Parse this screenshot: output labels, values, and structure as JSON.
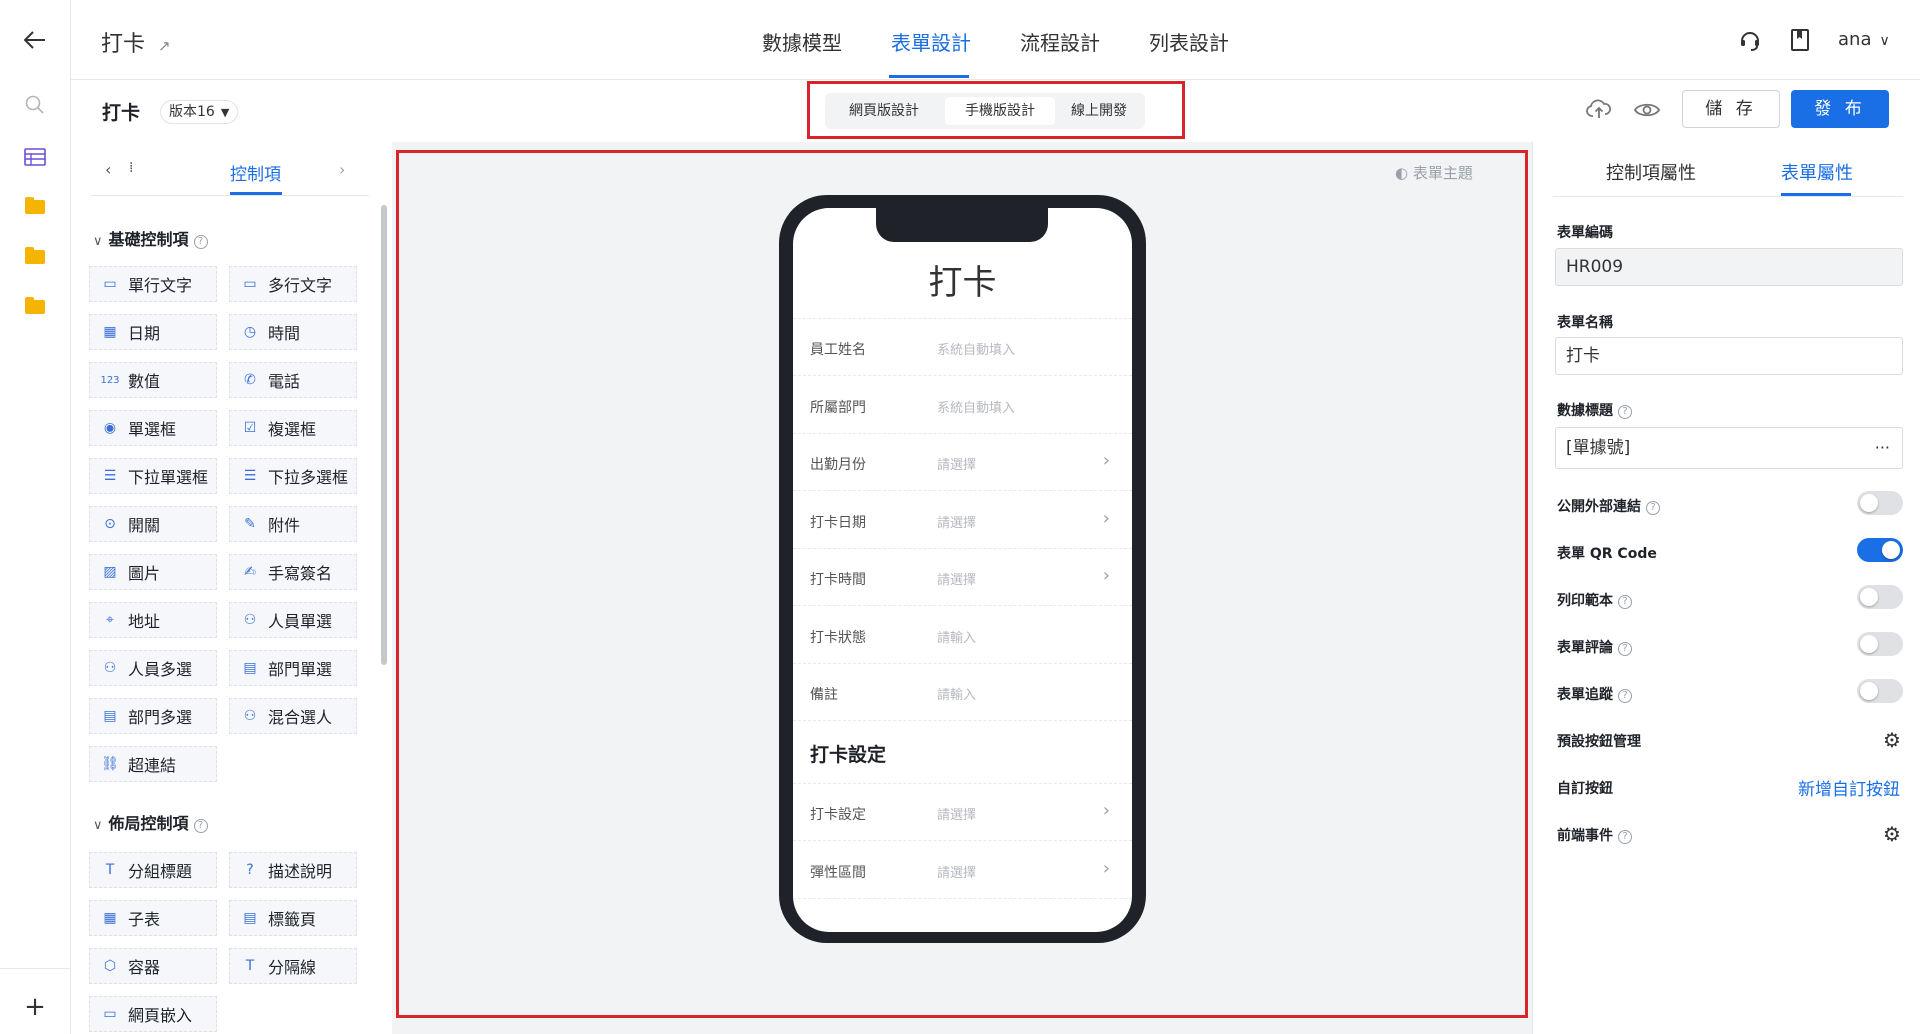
{
  "header": {
    "app_title": "打卡",
    "tabs": [
      "數據模型",
      "表單設計",
      "流程設計",
      "列表設計"
    ],
    "user": "ana"
  },
  "subheader": {
    "form_name": "打卡",
    "version": "版本16",
    "segments": [
      "網頁版設計",
      "手機版設計",
      "線上開發"
    ],
    "save_label": "儲 存",
    "publish_label": "發 布"
  },
  "palette": {
    "tab_label": "控制項",
    "basic_title": "基礎控制項",
    "basic_items": [
      "單行文字",
      "多行文字",
      "日期",
      "時間",
      "數值",
      "電話",
      "單選框",
      "複選框",
      "下拉單選框",
      "下拉多選框",
      "開關",
      "附件",
      "圖片",
      "手寫簽名",
      "地址",
      "人員單選",
      "人員多選",
      "部門單選",
      "部門多選",
      "混合選人",
      "超連結"
    ],
    "layout_title": "佈局控制項",
    "layout_items": [
      "分組標題",
      "描述說明",
      "子表",
      "標籤頁",
      "容器",
      "分隔線",
      "網頁嵌入"
    ]
  },
  "canvas": {
    "theme_label": "表單主題",
    "form_title": "打卡",
    "fields": [
      {
        "label": "員工姓名",
        "placeholder": "系統自動填入",
        "chevron": false
      },
      {
        "label": "所屬部門",
        "placeholder": "系統自動填入",
        "chevron": false
      },
      {
        "label": "出勤月份",
        "placeholder": "請選擇",
        "chevron": true
      },
      {
        "label": "打卡日期",
        "placeholder": "請選擇",
        "chevron": true
      },
      {
        "label": "打卡時間",
        "placeholder": "請選擇",
        "chevron": true
      },
      {
        "label": "打卡狀態",
        "placeholder": "請輸入",
        "chevron": false
      },
      {
        "label": "備註",
        "placeholder": "請輸入",
        "chevron": false
      }
    ],
    "section_title": "打卡設定",
    "section_fields": [
      {
        "label": "打卡設定",
        "placeholder": "請選擇",
        "chevron": true
      },
      {
        "label": "彈性區間",
        "placeholder": "請選擇",
        "chevron": true
      }
    ]
  },
  "props": {
    "tabs": [
      "控制項屬性",
      "表單屬性"
    ],
    "form_code_label": "表單編碼",
    "form_code_value": "HR009",
    "form_name_label": "表單名稱",
    "form_name_value": "打卡",
    "data_title_label": "數據標題",
    "data_title_value": "[單據號]",
    "public_link_label": "公開外部連結",
    "qr_label": "表單 QR Code",
    "print_label": "列印範本",
    "comment_label": "表單評論",
    "track_label": "表單追蹤",
    "preset_buttons_label": "預設按鈕管理",
    "custom_button_label": "自訂按鈕",
    "custom_button_action": "新增自訂按鈕",
    "frontend_event_label": "前端事件",
    "toggles": {
      "public_link": false,
      "qr": true,
      "print": false,
      "comment": false,
      "track": false
    }
  },
  "colors": {
    "accent": "#1a6ee6",
    "highlight_box": "#d9232d"
  }
}
